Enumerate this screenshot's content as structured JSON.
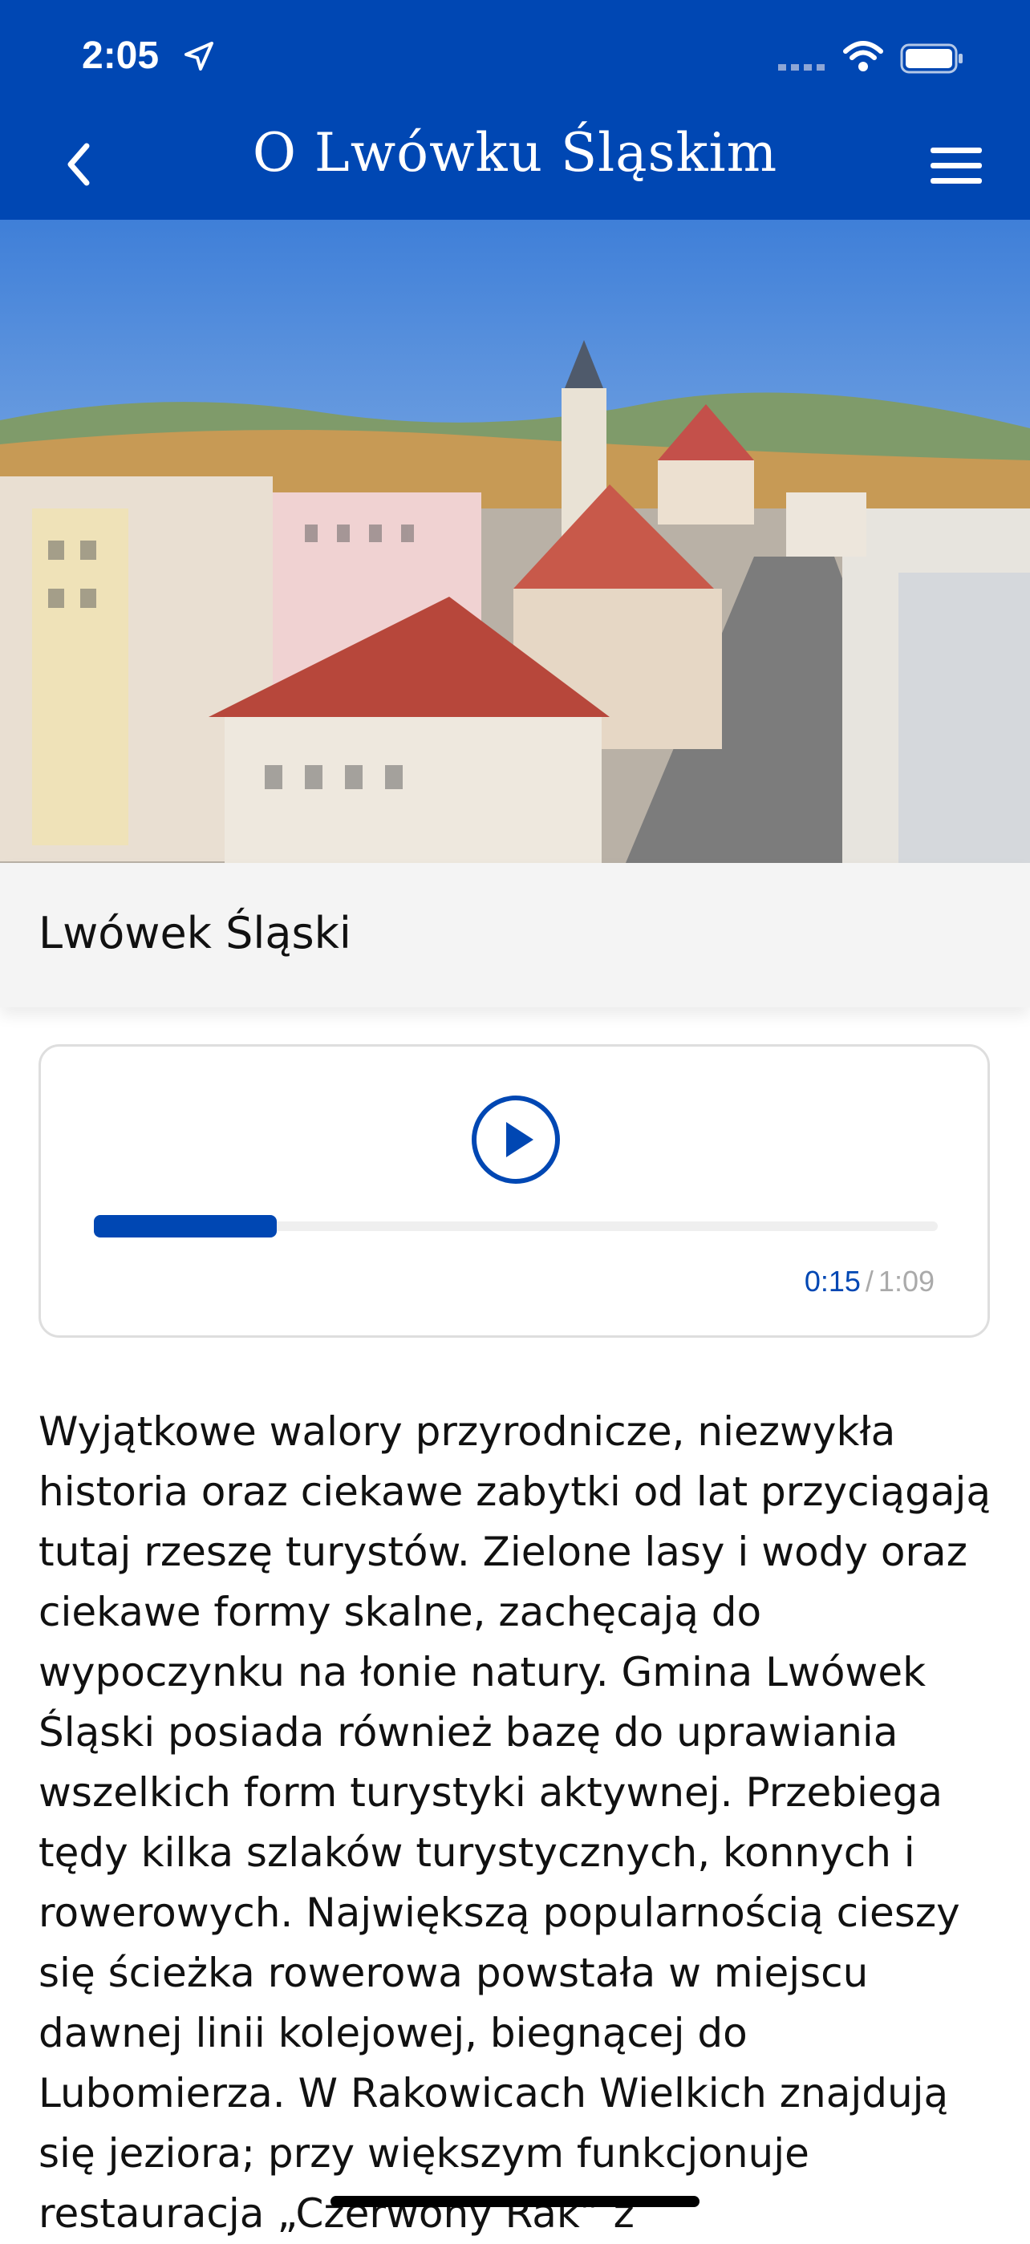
{
  "status_bar": {
    "time": "2:05"
  },
  "header": {
    "title": "O Lwówku Śląskim"
  },
  "place": {
    "title": "Lwówek Śląski"
  },
  "player": {
    "current_time": "0:15",
    "separator": "/",
    "duration": "1:09",
    "progress": 0.217
  },
  "description": "Wyjątkowe walory przyrodnicze, niezwykła historia oraz ciekawe zabytki od lat przyciągają tutaj rzeszę turystów. Zielone lasy i wody oraz ciekawe formy skalne, zachęcają do wypoczynku na łonie natury. Gmina Lwówek Śląski posiada również bazę do uprawiania wszelkich form turystyki aktywnej. Przebiega tędy kilka szlaków turystycznych, konnych i rowerowych. Największą popularnością cieszy się ścieżka rowerowa powstała w miejscu dawnej linii kolejowej, biegnącej do Lubomierza. W Rakowicach Wielkich znajdują się jeziora; przy większym funkcjonuje restauracja „Czerwony Rak” z",
  "colors": {
    "brand": "#0047B3"
  },
  "icons": [
    "location-arrow-icon",
    "signal-icon",
    "wifi-icon",
    "battery-icon",
    "back-chevron-icon",
    "hamburger-menu-icon",
    "play-icon"
  ]
}
